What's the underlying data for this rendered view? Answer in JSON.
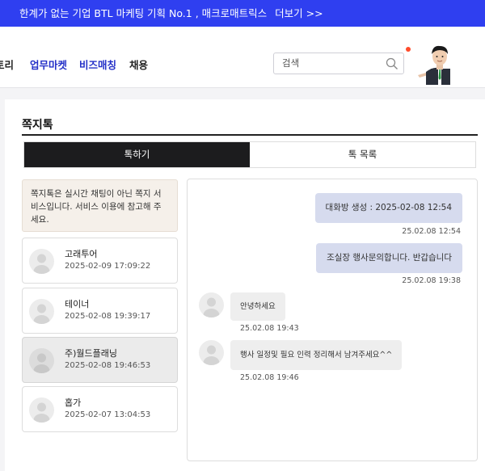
{
  "banner": {
    "text": "한계가 없는 기업 BTL 마케팅 기획 No.1 , 매크로매트릭스",
    "more": "더보기 >>"
  },
  "nav": {
    "items": [
      "토리",
      "업무마켓",
      "비즈매칭",
      "채용"
    ]
  },
  "search": {
    "placeholder": "검색"
  },
  "page": {
    "title": "쪽지톡"
  },
  "tabs": [
    "톡하기",
    "톡 목록"
  ],
  "notice": "쪽지톡은 실시간 채팅이 아닌 쪽지 서비스입니다. 서비스 이용에 참고해 주세요.",
  "conversations": [
    {
      "name": "고래투어",
      "time": "2025-02-09 17:09:22",
      "selected": false
    },
    {
      "name": "테이너",
      "time": "2025-02-08 19:39:17",
      "selected": false
    },
    {
      "name": "주)월드플래닝",
      "time": "2025-02-08 19:46:53",
      "selected": true
    },
    {
      "name": "홉가",
      "time": "2025-02-07 13:04:53",
      "selected": false
    }
  ],
  "messages": [
    {
      "side": "right",
      "text": "대화방 생성 : 2025-02-08 12:54",
      "time": "25.02.08 12:54"
    },
    {
      "side": "right",
      "text": "조실장 행사문의합니다. 반갑습니다",
      "time": "25.02.08 19:38"
    },
    {
      "side": "left",
      "text": "안녕하세요",
      "time": "25.02.08 19:43"
    },
    {
      "side": "left",
      "text": "행사 일정및 필요 인력 정리해서 남겨주세요^^",
      "time": "25.02.08 19:46"
    }
  ],
  "colors": {
    "banner": "#2f3ff0",
    "nav_active": "#2430c8",
    "tab_active": "#1c1c1e",
    "bubble_mine": "#d6dbee",
    "bubble_other": "#eeeeee",
    "notice_bg": "#f5f0ea"
  }
}
